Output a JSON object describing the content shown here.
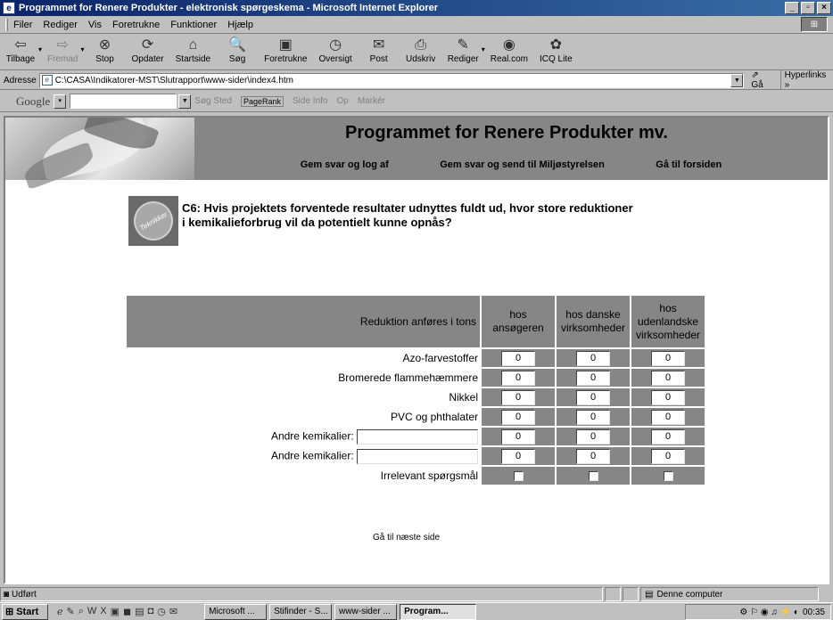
{
  "window": {
    "title": "Programmet for Renere Produkter - elektronisk spørgeskema - Microsoft Internet Explorer",
    "controls": [
      "_",
      "▫",
      "×"
    ]
  },
  "menu": [
    "Filer",
    "Rediger",
    "Vis",
    "Foretrukne",
    "Funktioner",
    "Hjælp"
  ],
  "toolbar": {
    "buttons": [
      {
        "label": "Tilbage",
        "icon": "back-arrow-icon",
        "glyph": "⇦"
      },
      {
        "label": "Fremad",
        "icon": "forward-arrow-icon",
        "glyph": "⇨"
      },
      {
        "label": "Stop",
        "icon": "stop-icon",
        "glyph": "⊗"
      },
      {
        "label": "Opdater",
        "icon": "refresh-icon",
        "glyph": "⟳"
      },
      {
        "label": "Startside",
        "icon": "home-icon",
        "glyph": "⌂"
      },
      {
        "label": "Søg",
        "icon": "search-icon",
        "glyph": "🔍"
      },
      {
        "label": "Foretrukne",
        "icon": "favorites-icon",
        "glyph": "▣"
      },
      {
        "label": "Oversigt",
        "icon": "history-icon",
        "glyph": "◷"
      },
      {
        "label": "Post",
        "icon": "mail-icon",
        "glyph": "✉"
      },
      {
        "label": "Udskriv",
        "icon": "print-icon",
        "glyph": "⎙"
      },
      {
        "label": "Rediger",
        "icon": "edit-icon",
        "glyph": "✎"
      },
      {
        "label": "Real.com",
        "icon": "realcom-icon",
        "glyph": "◉"
      },
      {
        "label": "ICQ Lite",
        "icon": "icq-icon",
        "glyph": "✿"
      }
    ]
  },
  "address": {
    "label": "Adresse",
    "url": "C:\\CASA\\Indikatorer-MST\\Slutrapport\\www-sider\\index4.htm",
    "go_label": "Gå",
    "links_label": "Hyperlinks »"
  },
  "google": {
    "logo": "Google",
    "items": [
      "Søg Sted",
      "PageRank",
      "Side Info",
      "Op",
      "Markér"
    ]
  },
  "page": {
    "title": "Programmet for Renere Produkter mv.",
    "links": [
      "Gem svar og log af",
      "Gem svar og send til Miljøstyrelsen",
      "Gå til forsiden"
    ],
    "badge_text": "Teknikker",
    "question_line1": "C6: Hvis projektets forventede resultater udnyttes fuldt ud, hvor store reduktioner",
    "question_line2": "i kemikalieforbrug vil da potentielt kunne opnås?",
    "table": {
      "header_label": "Reduktion anføres i tons",
      "columns": [
        {
          "l1": "hos",
          "l2": "ansøgeren",
          "l3": ""
        },
        {
          "l1": "hos danske",
          "l2": "virksomheder",
          "l3": ""
        },
        {
          "l1": "hos",
          "l2": "udenlandske",
          "l3": "virksomheder"
        }
      ],
      "rows": [
        {
          "label": "Azo-farvestoffer",
          "values": [
            "0",
            "0",
            "0"
          ]
        },
        {
          "label": "Bromerede flammehæmmere",
          "values": [
            "0",
            "0",
            "0"
          ]
        },
        {
          "label": "Nikkel",
          "values": [
            "0",
            "0",
            "0"
          ]
        },
        {
          "label": "PVC og phthalater",
          "values": [
            "0",
            "0",
            "0"
          ]
        },
        {
          "label": "Andre kemikalier:",
          "values": [
            "0",
            "0",
            "0"
          ],
          "other": ""
        },
        {
          "label": "Andre kemikalier:",
          "values": [
            "0",
            "0",
            "0"
          ],
          "other": ""
        }
      ],
      "irrelevant_label": "Irrelevant spørgsmål"
    },
    "next_link": "Gå til næste side"
  },
  "status": {
    "text": "Udført",
    "zone": "Denne computer"
  },
  "taskbar": {
    "start": "Start",
    "tasks": [
      "Microsoft ...",
      "Stifinder - S...",
      "www-sider ...",
      "Program..."
    ],
    "clock": "00:35"
  }
}
